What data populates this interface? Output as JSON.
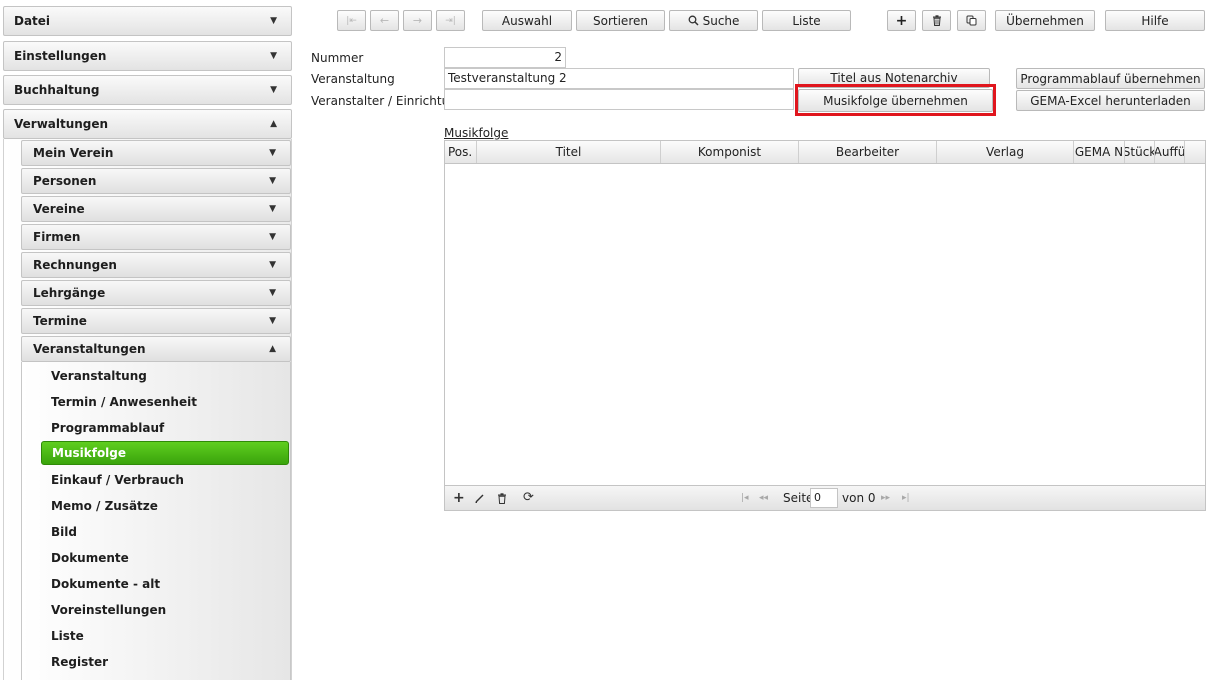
{
  "sidebar": {
    "top_sections": [
      {
        "label": "Datei"
      },
      {
        "label": "Einstellungen"
      },
      {
        "label": "Buchhaltung"
      },
      {
        "label": "Verwaltungen"
      }
    ],
    "verwaltungen_items": [
      {
        "label": "Mein Verein"
      },
      {
        "label": "Personen"
      },
      {
        "label": "Vereine"
      },
      {
        "label": "Firmen"
      },
      {
        "label": "Rechnungen"
      },
      {
        "label": "Lehrgänge"
      },
      {
        "label": "Termine"
      },
      {
        "label": "Veranstaltungen"
      }
    ],
    "veranstaltungen_items": [
      {
        "label": "Veranstaltung"
      },
      {
        "label": "Termin / Anwesenheit"
      },
      {
        "label": "Programmablauf"
      },
      {
        "label": "Musikfolge",
        "active": true
      },
      {
        "label": "Einkauf / Verbrauch"
      },
      {
        "label": "Memo / Zusätze"
      },
      {
        "label": "Bild"
      },
      {
        "label": "Dokumente"
      },
      {
        "label": "Dokumente - alt"
      },
      {
        "label": "Voreinstellungen"
      },
      {
        "label": "Liste"
      },
      {
        "label": "Register"
      }
    ],
    "active_color": "#4cb818"
  },
  "toolbar": {
    "auswahl": "Auswahl",
    "sortieren": "Sortieren",
    "suche": "Suche",
    "liste": "Liste",
    "uebernehmen": "Übernehmen",
    "hilfe": "Hilfe"
  },
  "form": {
    "nummer_label": "Nummer",
    "nummer_value": "2",
    "veranstaltung_label": "Veranstaltung",
    "veranstaltung_value": "Testveranstaltung 2",
    "veranstalter_label": "Veranstalter / Einrichtung",
    "veranstalter_value": "",
    "btn_titel_notenarchiv": "Titel aus Notenarchiv",
    "btn_musikfolge_uebernehmen": "Musikfolge übernehmen",
    "btn_programmablauf_uebernehmen": "Programmablauf übernehmen",
    "btn_gema_excel": "GEMA-Excel herunterladen",
    "highlight_color": "#e0151d"
  },
  "grid": {
    "caption": "Musikfolge",
    "columns": [
      "Pos.",
      "Titel",
      "Komponist",
      "Bearbeiter",
      "Verlag",
      "GEMA N",
      "Stück",
      "Auffü"
    ],
    "rows": [],
    "pager": {
      "page_label": "Seite",
      "page_value": "0",
      "of_label": "von 0"
    }
  }
}
